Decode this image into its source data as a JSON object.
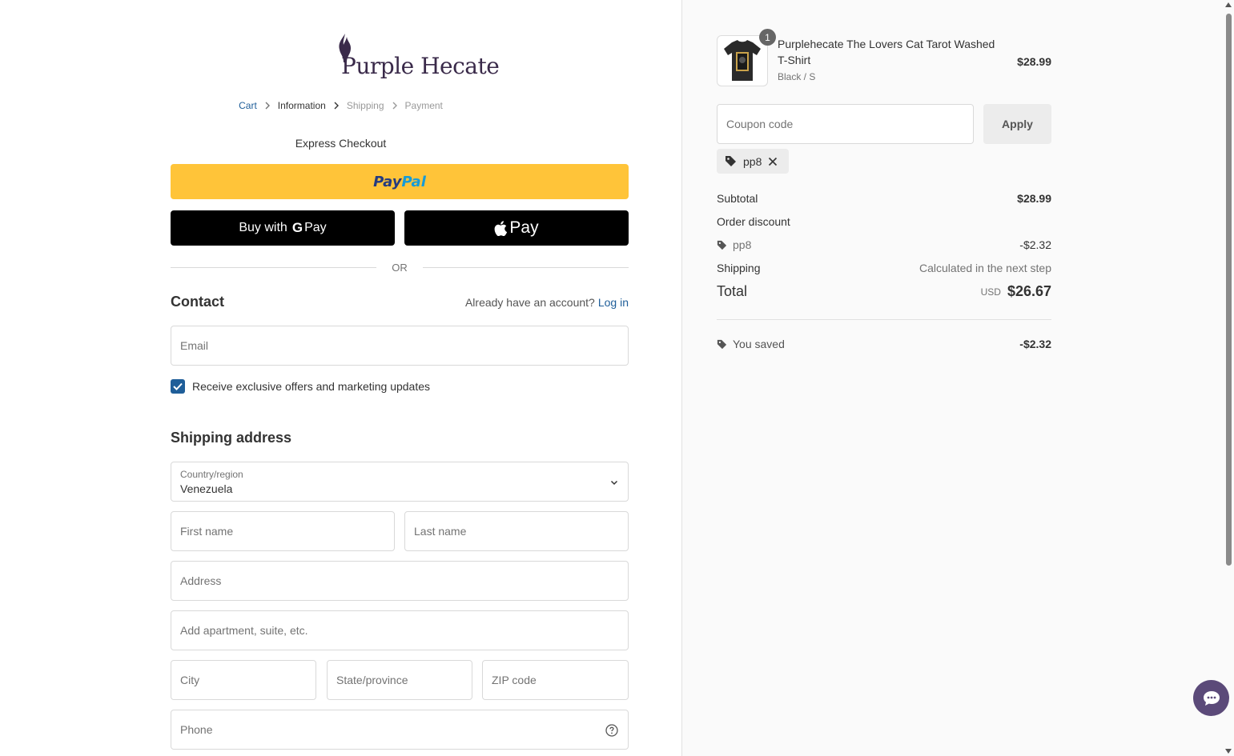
{
  "brand": {
    "name": "Purple Hecate",
    "color": "#3a2a4a"
  },
  "breadcrumb": {
    "items": [
      {
        "label": "Cart",
        "state": "link"
      },
      {
        "label": "Information",
        "state": "current"
      },
      {
        "label": "Shipping",
        "state": "disabled"
      },
      {
        "label": "Payment",
        "state": "disabled"
      }
    ]
  },
  "express": {
    "title": "Express Checkout",
    "paypal_label_a": "Pay",
    "paypal_label_b": "Pal",
    "gpay_prefix": "Buy with",
    "gpay_g": "G",
    "gpay_label": "Pay",
    "apay_label": "Pay",
    "or_text": "OR"
  },
  "contact": {
    "heading": "Contact",
    "account_prompt": "Already have an account?",
    "login_label": "Log in",
    "email_placeholder": "Email",
    "marketing_label": "Receive exclusive offers and marketing updates",
    "marketing_checked": true
  },
  "shipping": {
    "heading": "Shipping address",
    "country_label": "Country/region",
    "country_value": "Venezuela",
    "first_name_placeholder": "First name",
    "last_name_placeholder": "Last name",
    "address_placeholder": "Address",
    "apartment_placeholder": "Add apartment, suite, etc.",
    "city_placeholder": "City",
    "state_placeholder": "State/province",
    "zip_placeholder": "ZIP code",
    "phone_placeholder": "Phone"
  },
  "order": {
    "item": {
      "name": "Purplehecate The Lovers Cat Tarot Washed T-Shirt",
      "variant": "Black / S",
      "price": "$28.99",
      "quantity": "1"
    },
    "coupon_placeholder": "Coupon code",
    "apply_label": "Apply",
    "applied_code": "pp8",
    "subtotal_label": "Subtotal",
    "subtotal_value": "$28.99",
    "discount_label": "Order discount",
    "discount_code": "pp8",
    "discount_value": "-$2.32",
    "shipping_label": "Shipping",
    "shipping_value": "Calculated in the next step",
    "total_label": "Total",
    "currency": "USD",
    "total_value": "$26.67",
    "saved_label": "You saved",
    "saved_value": "-$2.32"
  },
  "colors": {
    "accent": "#1f5e99",
    "paypal_yellow": "#ffc439",
    "chat": "#5b4a79"
  }
}
